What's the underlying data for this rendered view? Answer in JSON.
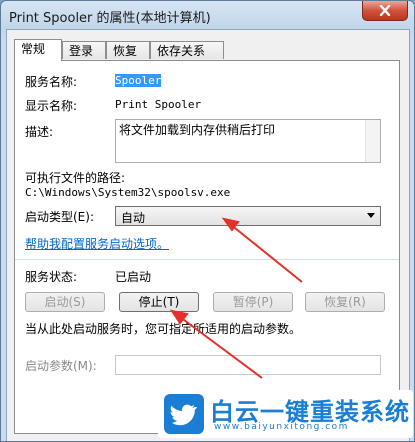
{
  "window": {
    "title": "Print Spooler 的属性(本地计算机)"
  },
  "tabs": [
    {
      "label": "常规",
      "active": true
    },
    {
      "label": "登录",
      "active": false
    },
    {
      "label": "恢复",
      "active": false
    },
    {
      "label": "依存关系",
      "active": false
    }
  ],
  "general": {
    "service_name_label": "服务名称:",
    "service_name_value": "Spooler",
    "display_name_label": "显示名称:",
    "display_name_value": "Print Spooler",
    "description_label": "描述:",
    "description_value": "将文件加载到内存供稍后打印",
    "exe_path_label": "可执行文件的路径:",
    "exe_path_value": "C:\\Windows\\System32\\spoolsv.exe",
    "startup_type_label": "启动类型(E):",
    "startup_type_value": "自动",
    "help_link": "帮助我配置服务启动选项。",
    "status_label": "服务状态:",
    "status_value": "已启动",
    "buttons": {
      "start": "启动(S)",
      "stop": "停止(T)",
      "pause": "暂停(P)",
      "resume": "恢复(R)"
    },
    "hint": "当从此处启动服务时，您可指定所适用的启动参数。",
    "start_params_label": "启动参数(M):",
    "start_params_value": ""
  },
  "footer": {
    "ok_partial": "定",
    "cancel_partial": "取消"
  },
  "watermark": {
    "title": "白云一键重装系统",
    "url": "www.baiyunxitong.com"
  },
  "colors": {
    "arrow": "#e5312a",
    "link": "#0066cc",
    "selection": "#3399ff",
    "watermark_blue": "#1a7fd4"
  },
  "icons": [
    "close-icon",
    "dropdown-arrow-icon",
    "twitter-bird-icon"
  ]
}
